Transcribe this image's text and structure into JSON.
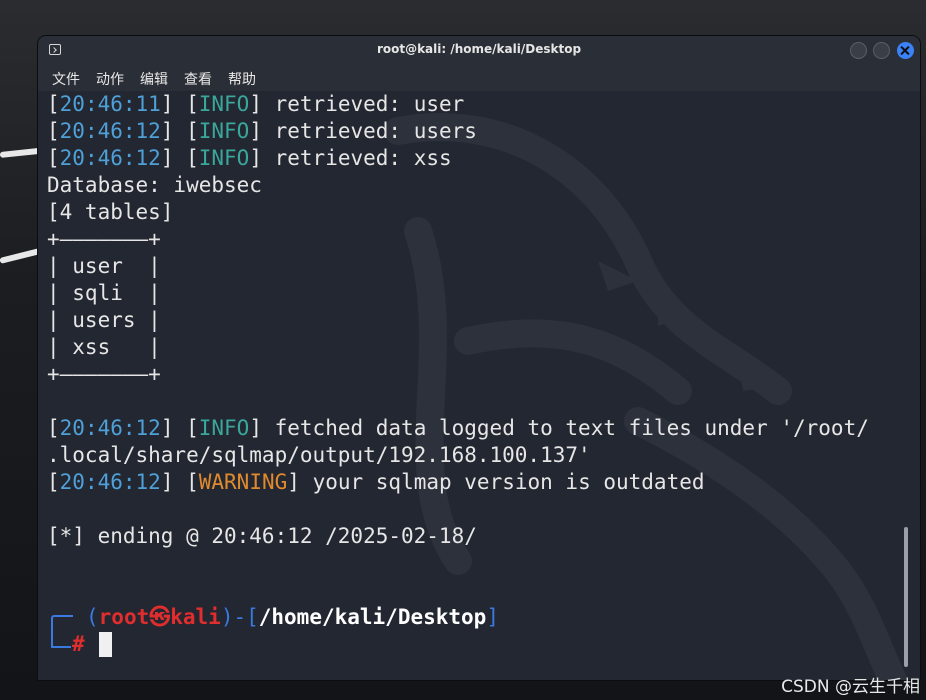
{
  "window": {
    "title": "root@kali: /home/kali/Desktop"
  },
  "menu": {
    "file": "文件",
    "action": "动作",
    "edit": "编辑",
    "view": "查看",
    "help": "帮助"
  },
  "terminal": {
    "log1": {
      "time": "20:46:11",
      "level": "INFO",
      "msg": " retrieved: user"
    },
    "log2": {
      "time": "20:46:12",
      "level": "INFO",
      "msg": " retrieved: users"
    },
    "log3": {
      "time": "20:46:12",
      "level": "INFO",
      "msg": " retrieved: xss"
    },
    "database_line": "Database: iwebsec",
    "tables_count_line": "[4 tables]",
    "table_border": "+———————+",
    "table_rows": [
      "| user  |",
      "| sqli  |",
      "| users |",
      "| xss   |"
    ],
    "log4": {
      "time": "20:46:12",
      "level": "INFO",
      "msg": " fetched data logged to text files under '/root/"
    },
    "log4_cont": ".local/share/sqlmap/output/192.168.100.137'",
    "log5": {
      "time": "20:46:12",
      "level": "WARNING",
      "msg": " your sqlmap version is outdated"
    },
    "ending_line": "[*] ending @ 20:46:12 /2025-02-18/",
    "prompt": {
      "open": "(",
      "user": "root",
      "at_symbol": "㉿",
      "host": "kali",
      "close_sep": ")-[",
      "path": "/home/kali/Desktop",
      "path_close": "]",
      "hash": "#"
    }
  },
  "watermark": "CSDN @云生千相",
  "colors": {
    "timestamp": "#4fa0d8",
    "info": "#3aa79b",
    "warning": "#e08a2e",
    "prompt_red": "#e02d2d",
    "prompt_blue": "#3a7ae0",
    "close_button": "#3b82f6"
  },
  "icons": {
    "window": "terminal-icon",
    "close": "close-icon"
  }
}
